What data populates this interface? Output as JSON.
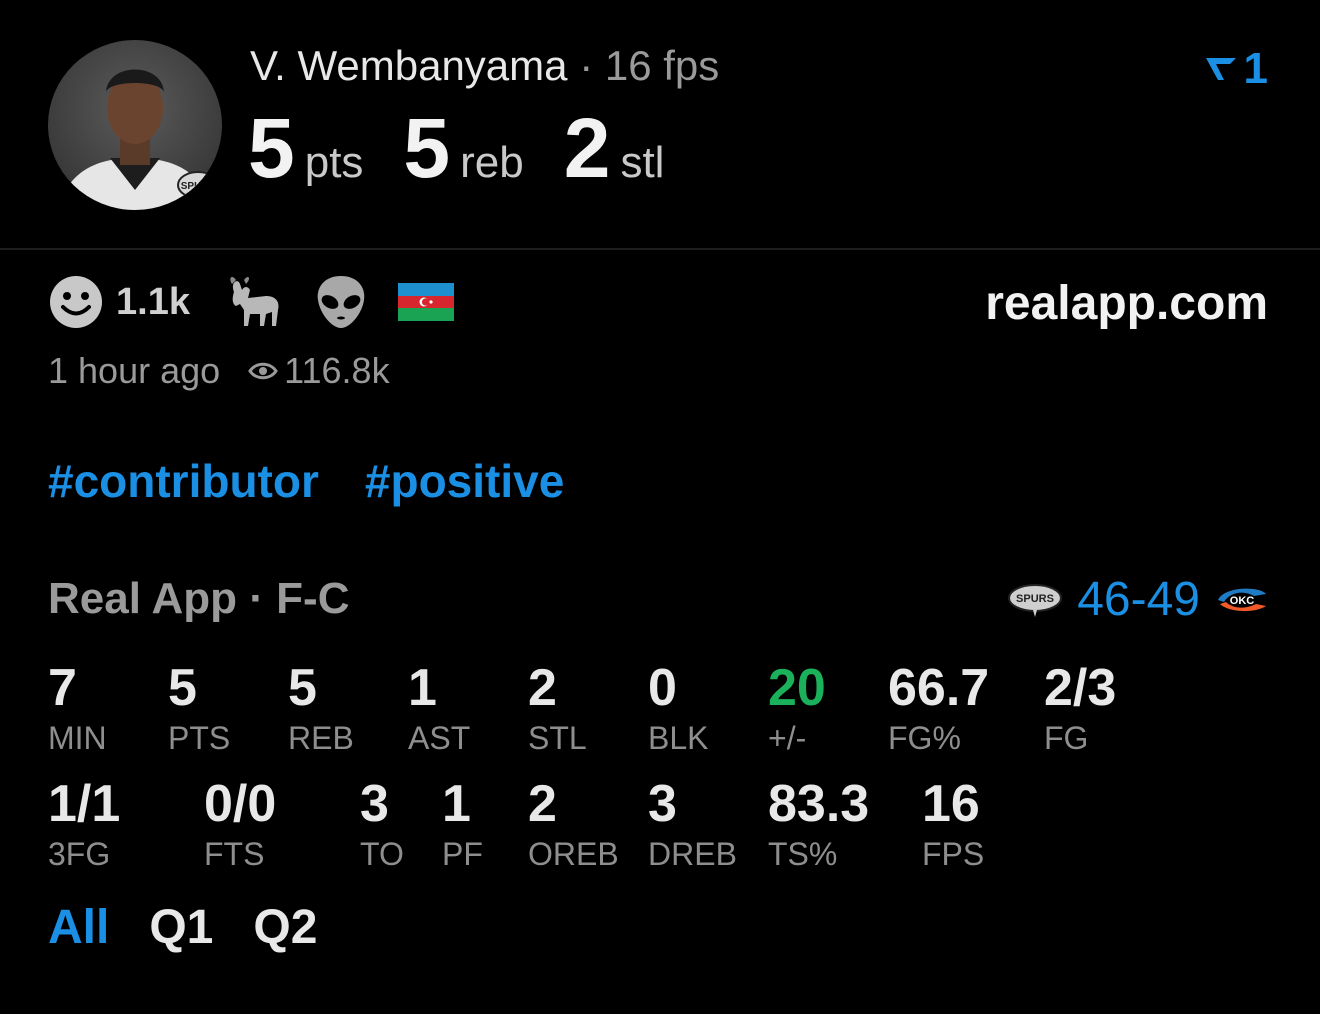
{
  "header": {
    "player_name": "V. Wembanyama",
    "separator": "·",
    "fps": "16 fps",
    "rank": "1",
    "headline_stats": [
      {
        "value": "5",
        "unit": "pts"
      },
      {
        "value": "5",
        "unit": "reb"
      },
      {
        "value": "2",
        "unit": "stl"
      }
    ]
  },
  "reactions": {
    "count": "1.1k",
    "icons": [
      "smiley-icon",
      "goat-icon",
      "alien-icon",
      "azerbaijan-flag-icon"
    ]
  },
  "site": "realapp.com",
  "meta": {
    "time": "1 hour ago",
    "views": "116.8k"
  },
  "tags": [
    "#contributor",
    "#positive"
  ],
  "team_line": "Real App · F-C",
  "score": "46-49",
  "stats_row1": [
    {
      "value": "7",
      "label": "MIN"
    },
    {
      "value": "5",
      "label": "PTS"
    },
    {
      "value": "5",
      "label": "REB"
    },
    {
      "value": "1",
      "label": "AST"
    },
    {
      "value": "2",
      "label": "STL"
    },
    {
      "value": "0",
      "label": "BLK"
    },
    {
      "value": "20",
      "label": "+/-"
    },
    {
      "value": "66.7",
      "label": "FG%"
    },
    {
      "value": "2/3",
      "label": "FG"
    }
  ],
  "stats_row2": [
    {
      "value": "1/1",
      "label": "3FG"
    },
    {
      "value": "0/0",
      "label": "FTS"
    },
    {
      "value": "3",
      "label": "TO"
    },
    {
      "value": "1",
      "label": "PF"
    },
    {
      "value": "2",
      "label": "OREB"
    },
    {
      "value": "3",
      "label": "DREB"
    },
    {
      "value": "83.3",
      "label": "TS%"
    },
    {
      "value": "16",
      "label": "FPS"
    }
  ],
  "periods": [
    "All",
    "Q1",
    "Q2"
  ],
  "colors": {
    "accent": "#1a8fe3",
    "positive": "#1bb15b",
    "background": "#000000"
  }
}
